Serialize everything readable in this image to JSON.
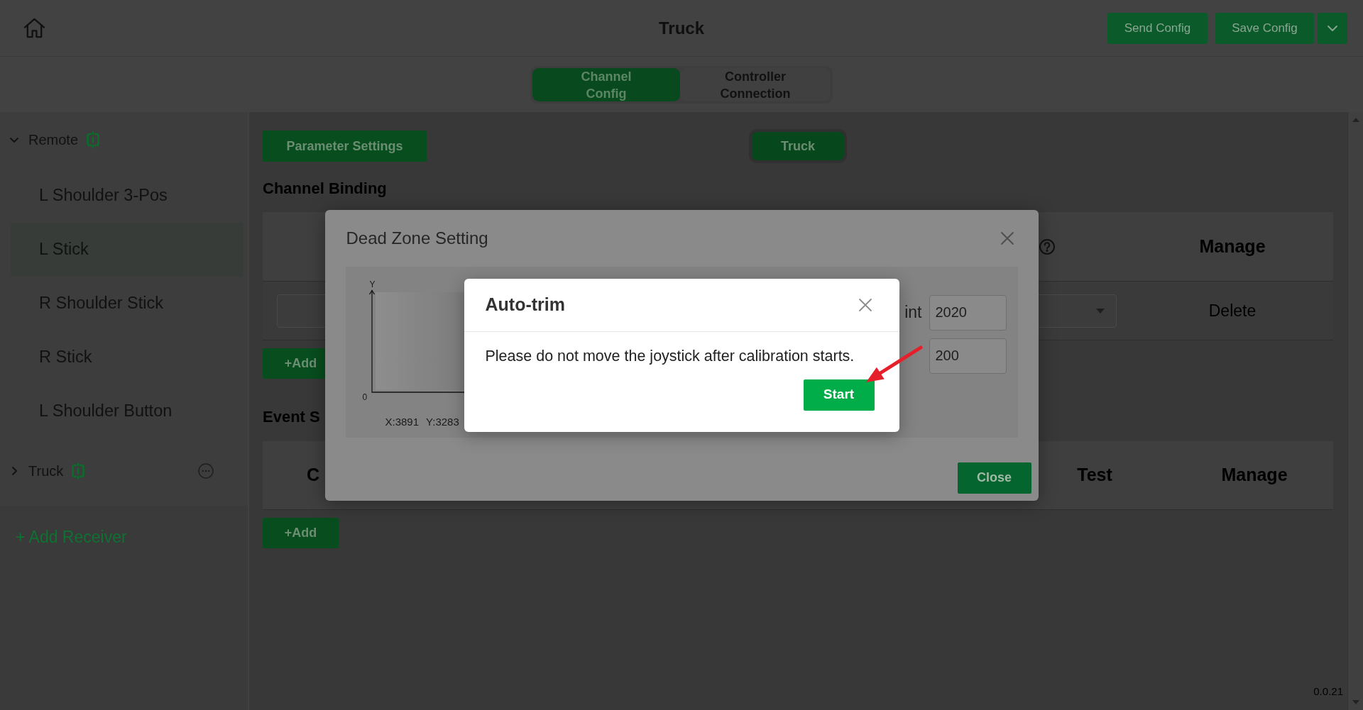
{
  "header": {
    "title": "Truck",
    "buttons": [
      {
        "label": "Send Config"
      },
      {
        "label": "Save Config"
      }
    ]
  },
  "tabs": [
    {
      "label": "Channel Config",
      "selected": true
    },
    {
      "label": "Controller Connection",
      "selected": false
    }
  ],
  "sidebar": {
    "receivers": [
      {
        "name": "Remote",
        "expanded": true,
        "actions_visible": false,
        "children": [
          {
            "label": "L Shoulder 3-Pos",
            "selected": false
          },
          {
            "label": "L Stick",
            "selected": true
          },
          {
            "label": "R Shoulder Stick",
            "selected": false
          },
          {
            "label": "R Stick",
            "selected": false
          },
          {
            "label": "L Shoulder Button",
            "selected": false
          }
        ]
      },
      {
        "name": "Truck",
        "expanded": false,
        "actions_visible": true
      }
    ],
    "add_receiver": "+ Add Receiver"
  },
  "toolbar": {
    "parameter_button": "Parameter Settings",
    "receiver_button": "Truck"
  },
  "channel_binding": {
    "title": "Channel Binding",
    "columns": [
      {
        "label": "Manage"
      }
    ],
    "rows": [
      {
        "action": "Delete"
      }
    ],
    "add_button": "+Add"
  },
  "event_settings": {
    "title": "Event S",
    "columns": [
      {
        "label": "C"
      },
      {
        "label": "Test"
      },
      {
        "label": "Manage"
      }
    ],
    "add_button": "+Add"
  },
  "version": "0.0.21",
  "dead_zone_dialog": {
    "title": "Dead Zone Setting",
    "plot": {
      "y_axis_label": "Y",
      "origin_label": "0",
      "readings": [
        "X:3891",
        "Y:3283"
      ]
    },
    "fields": [
      {
        "label": "int",
        "value": "2020"
      },
      {
        "value": "200"
      }
    ],
    "close_button": "Close"
  },
  "auto_trim_dialog": {
    "title": "Auto-trim",
    "message": "Please do not move the joystick after calibration starts.",
    "start_button": "Start"
  }
}
